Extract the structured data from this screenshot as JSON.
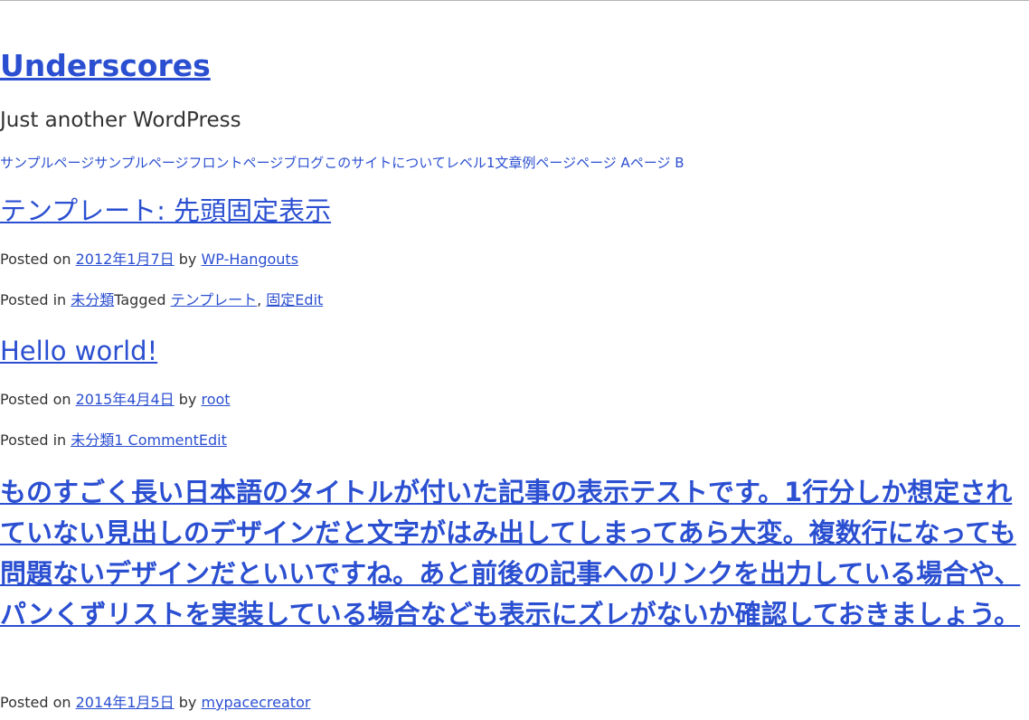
{
  "site": {
    "title": "Underscores",
    "description": "Just another WordPress"
  },
  "nav": {
    "items": [
      "サンプルページ",
      "サンプルページ",
      "フロントページ",
      "ブログ",
      "このサイトについて",
      "レベル1",
      "文章例",
      "ページ",
      "ページ A",
      "ページ B"
    ]
  },
  "posts": [
    {
      "title": "テンプレート: 先頭固定表示",
      "posted_on": "Posted on ",
      "date": "2012年1月7日",
      "by": " by ",
      "author": "WP-Hangouts",
      "posted_in": "Posted in ",
      "category": "未分類",
      "tagged": "Tagged ",
      "tag1": "テンプレート",
      "comma": ", ",
      "tag2": "固定",
      "edit": "Edit"
    },
    {
      "title": "Hello world!",
      "posted_on": "Posted on ",
      "date": "2015年4月4日",
      "by": " by ",
      "author": "root",
      "posted_in": "Posted in ",
      "category": "未分類",
      "comments": "1 Comment",
      "edit": "Edit"
    },
    {
      "title": "ものすごく長い日本語のタイトルが付いた記事の表示テストです。1行分しか想定されていない見出しのデザインだと文字がはみ出してしまってあら大変。複数行になっても問題ないデザインだといいですね。あと前後の記事へのリンクを出力している場合や、パンくずリストを実装している場合なども表示にズレがないか確認しておきましょう。",
      "posted_on": "Posted on ",
      "date": "2014年1月5日",
      "by": " by ",
      "author": "mypacecreator"
    }
  ],
  "colors": {
    "link": "#2b4fd1",
    "text": "#333333",
    "background": "#ffffff"
  }
}
